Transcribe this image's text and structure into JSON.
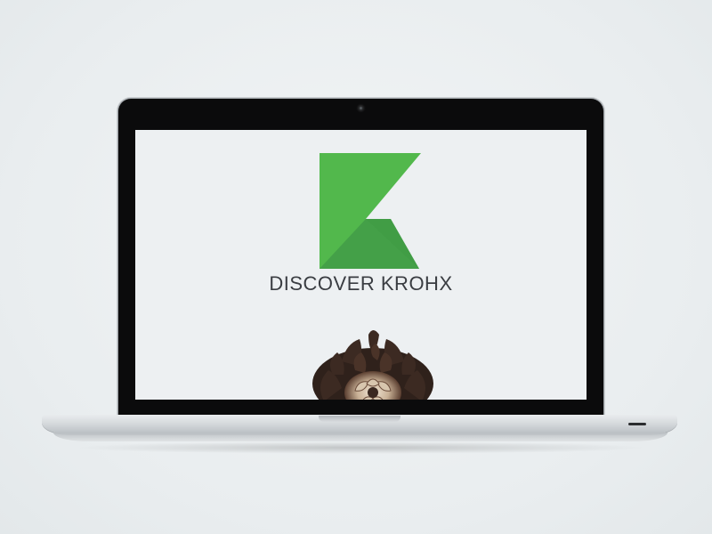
{
  "page": {
    "brand_text": "DISCOVER KROHX",
    "logo_icon": "krohx-k-logo-icon",
    "photo_icon": "pinecone-image",
    "colors": {
      "logo_light_green": "#52b84c",
      "logo_dark_green": "#44a048",
      "brand_text": "#3a3d42",
      "screen_bg": "#edf0f2",
      "bezel": "#0b0b0c"
    }
  }
}
